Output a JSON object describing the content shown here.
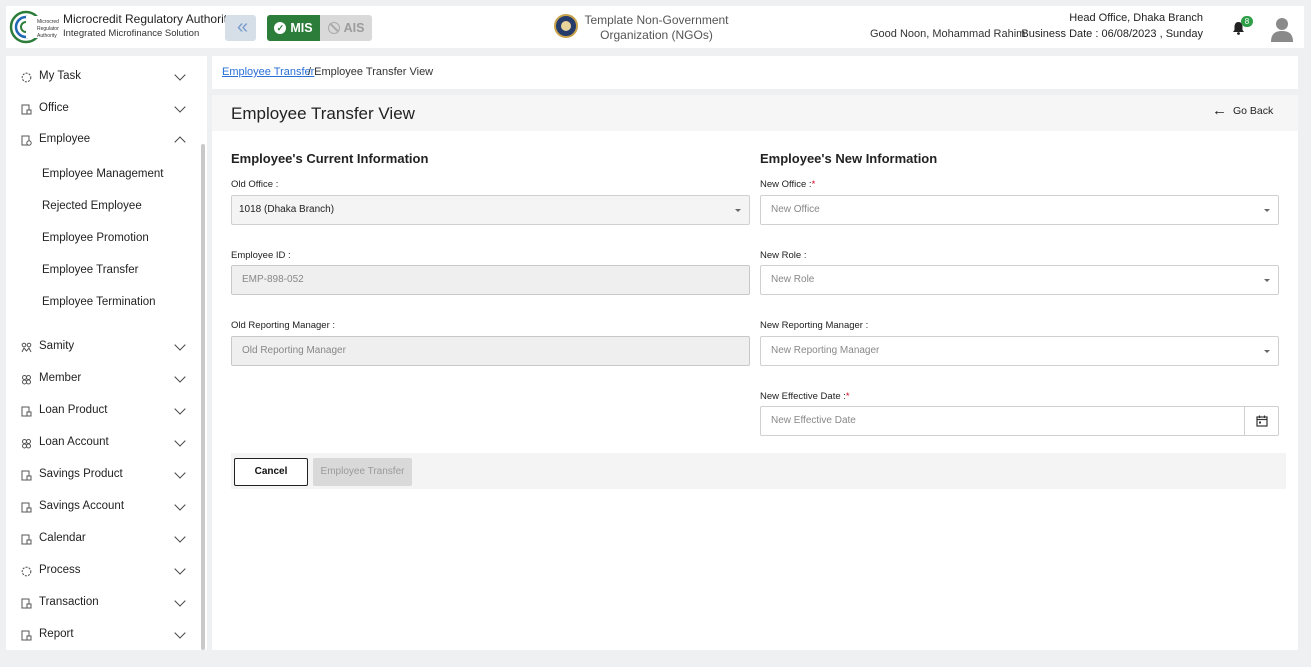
{
  "header": {
    "brand_title": "Microcredit Regulatory Authority",
    "brand_subtitle": "Integrated Microfinance Solution",
    "logo_text": "Microcredit Regulatory Authority",
    "mis_label": "MIS",
    "ais_label": "AIS",
    "org_name": "Template Non-Government Organization (NGOs)",
    "greeting": "Good Noon, Mohammad Rahim",
    "branch": "Head Office, Dhaka Branch",
    "business_date": "Business Date : 06/08/2023 , Sunday",
    "notification_count": "8",
    "accent_color": "#2d7d3a"
  },
  "sidebar": {
    "items": [
      {
        "label": "My Task",
        "icon": "task-icon"
      },
      {
        "label": "Office",
        "icon": "office-icon"
      },
      {
        "label": "Employee",
        "icon": "employee-icon",
        "expanded": true
      },
      {
        "label": "Samity",
        "icon": "samity-icon"
      },
      {
        "label": "Member",
        "icon": "member-icon"
      },
      {
        "label": "Loan Product",
        "icon": "loan-product-icon"
      },
      {
        "label": "Loan Account",
        "icon": "loan-account-icon"
      },
      {
        "label": "Savings Product",
        "icon": "savings-product-icon"
      },
      {
        "label": "Savings Account",
        "icon": "savings-account-icon"
      },
      {
        "label": "Calendar",
        "icon": "calendar-icon"
      },
      {
        "label": "Process",
        "icon": "process-icon"
      },
      {
        "label": "Transaction",
        "icon": "transaction-icon"
      },
      {
        "label": "Report",
        "icon": "report-icon"
      }
    ],
    "employee_sub": [
      "Employee Management",
      "Rejected Employee",
      "Employee Promotion",
      "Employee Transfer",
      "Employee Termination"
    ]
  },
  "breadcrumb": {
    "link": "Employee Transfer",
    "current": "/ Employee Transfer View"
  },
  "page": {
    "title": "Employee Transfer View",
    "go_back": "Go Back"
  },
  "current_info": {
    "heading": "Employee's Current Information",
    "old_office_label": "Old Office :",
    "old_office_value": "1018 (Dhaka Branch)",
    "employee_id_label": "Employee ID :",
    "employee_id_value": "EMP-898-052",
    "old_manager_label": "Old Reporting Manager :",
    "old_manager_placeholder": "Old Reporting Manager"
  },
  "new_info": {
    "heading": "Employee's New Information",
    "new_office_label": "New Office :",
    "new_office_placeholder": "New Office",
    "new_role_label": "New Role :",
    "new_role_placeholder": "New Role",
    "new_manager_label": "New Reporting Manager :",
    "new_manager_placeholder": "New Reporting Manager",
    "effective_date_label": "New Effective Date :",
    "effective_date_placeholder": "New Effective Date",
    "required_mark": "*"
  },
  "actions": {
    "cancel": "Cancel",
    "transfer": "Employee Transfer"
  }
}
